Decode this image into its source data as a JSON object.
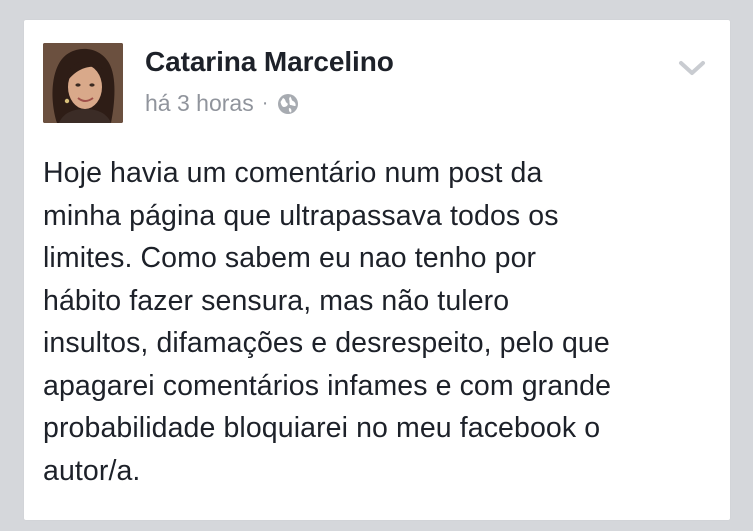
{
  "post": {
    "author": "Catarina Marcelino",
    "timestamp": "há 3 horas",
    "separator": "·",
    "audience_icon": "globe-icon",
    "menu_icon": "chevron-down-icon",
    "text": "Hoje havia um comentário num post da\nminha página que ultrapassava todos os\nlimites. Como sabem eu nao tenho por\nhábito fazer sensura, mas não tulero\ninsultos, difamações e desrespeito, pelo que\napagarei comentários infames e com grande\nprobabilidade bloquiarei no meu facebook o\nautor/a."
  },
  "colors": {
    "background": "#d5d7db",
    "card": "#ffffff",
    "text": "#1d2129",
    "meta": "#90949c"
  }
}
